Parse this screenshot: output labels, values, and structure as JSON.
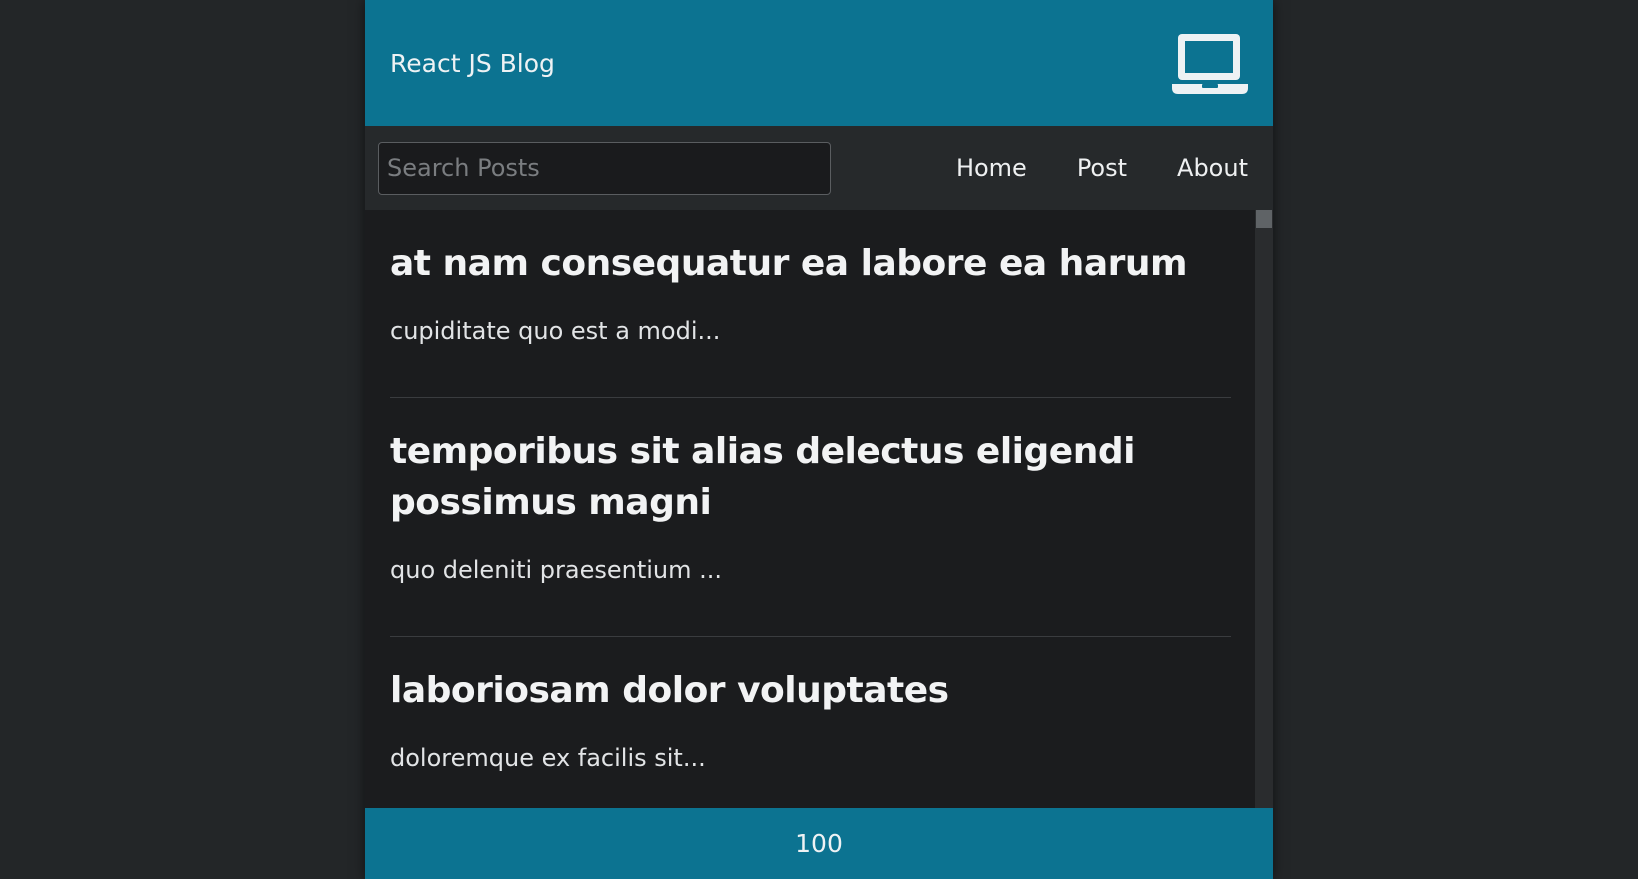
{
  "header": {
    "title": "React JS Blog",
    "icon": "laptop-icon"
  },
  "nav": {
    "search_placeholder": "Search Posts",
    "search_value": "",
    "links": [
      {
        "label": "Home"
      },
      {
        "label": "Post"
      },
      {
        "label": "About"
      }
    ]
  },
  "posts": [
    {
      "title": "at nam consequatur ea labore ea harum",
      "body": "cupiditate quo est a modi..."
    },
    {
      "title": "temporibus sit alias delectus eligendi possimus magni",
      "body": "quo deleniti praesentium ..."
    },
    {
      "title": "laboriosam dolor voluptates",
      "body": "doloremque ex facilis sit..."
    }
  ],
  "footer": {
    "count": "100"
  },
  "colors": {
    "accent": "#0c7391",
    "background": "#1b1c1e",
    "nav_background": "#26292b",
    "page_background": "#232628"
  }
}
